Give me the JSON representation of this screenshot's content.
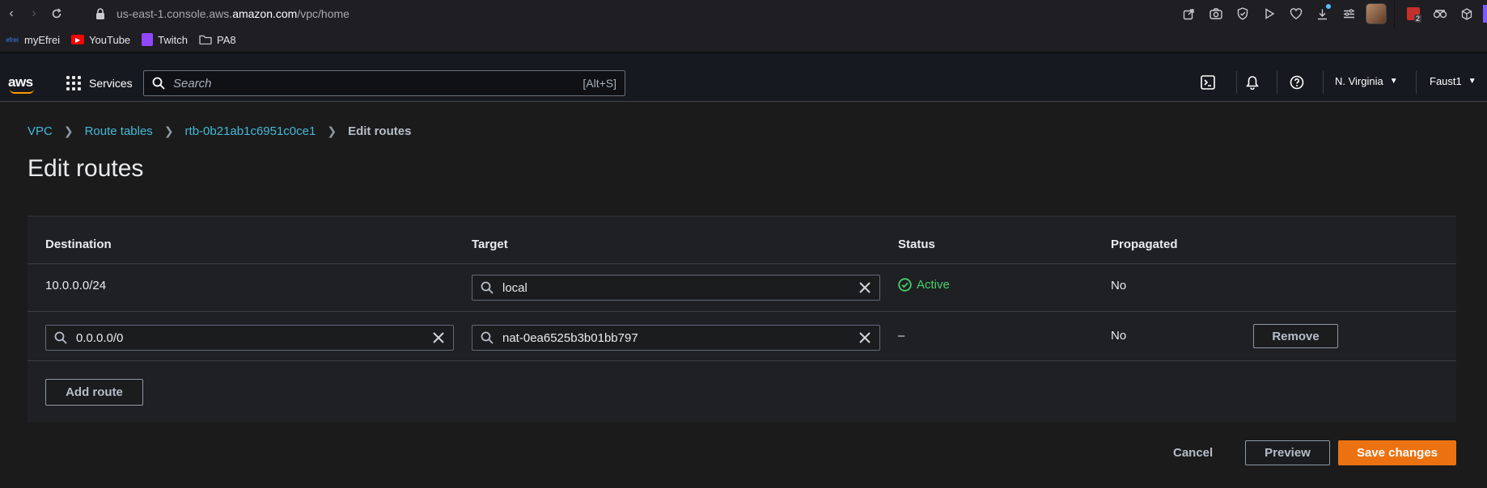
{
  "browser": {
    "url_prefix": "us-east-1.console.aws.",
    "url_host": "amazon.com",
    "url_path": "/vpc/home",
    "download_badge": "2"
  },
  "bookmarks": [
    {
      "label": "myEfrei",
      "icon": "efrei-icon"
    },
    {
      "label": "YouTube",
      "icon": "youtube-icon",
      "color": "#ff0000"
    },
    {
      "label": "Twitch",
      "icon": "twitch-icon",
      "color": "#9146ff"
    },
    {
      "label": "PA8",
      "icon": "folder-icon"
    }
  ],
  "aws_header": {
    "logo": "aws",
    "services_label": "Services",
    "search_placeholder": "Search",
    "search_shortcut": "[Alt+S]",
    "region": "N. Virginia",
    "account": "Faust1"
  },
  "breadcrumb": {
    "items": [
      "VPC",
      "Route tables",
      "rtb-0b21ab1c6951c0ce1"
    ],
    "current": "Edit routes"
  },
  "page_title": "Edit routes",
  "table": {
    "headers": [
      "Destination",
      "Target",
      "Status",
      "Propagated"
    ],
    "rows": [
      {
        "destination": "10.0.0.0/24",
        "target": "local",
        "status": "Active",
        "propagated": "No"
      },
      {
        "destination": "0.0.0.0/0",
        "target": "nat-0ea6525b3b01bb797",
        "status": "–",
        "propagated": "No",
        "action": "Remove"
      }
    ],
    "add_route_label": "Add route"
  },
  "footer": {
    "cancel_label": "Cancel",
    "preview_label": "Preview",
    "save_label": "Save changes"
  },
  "colors": {
    "link": "#44b9d6",
    "primary": "#ec7211",
    "status_ok": "#47d16a"
  }
}
